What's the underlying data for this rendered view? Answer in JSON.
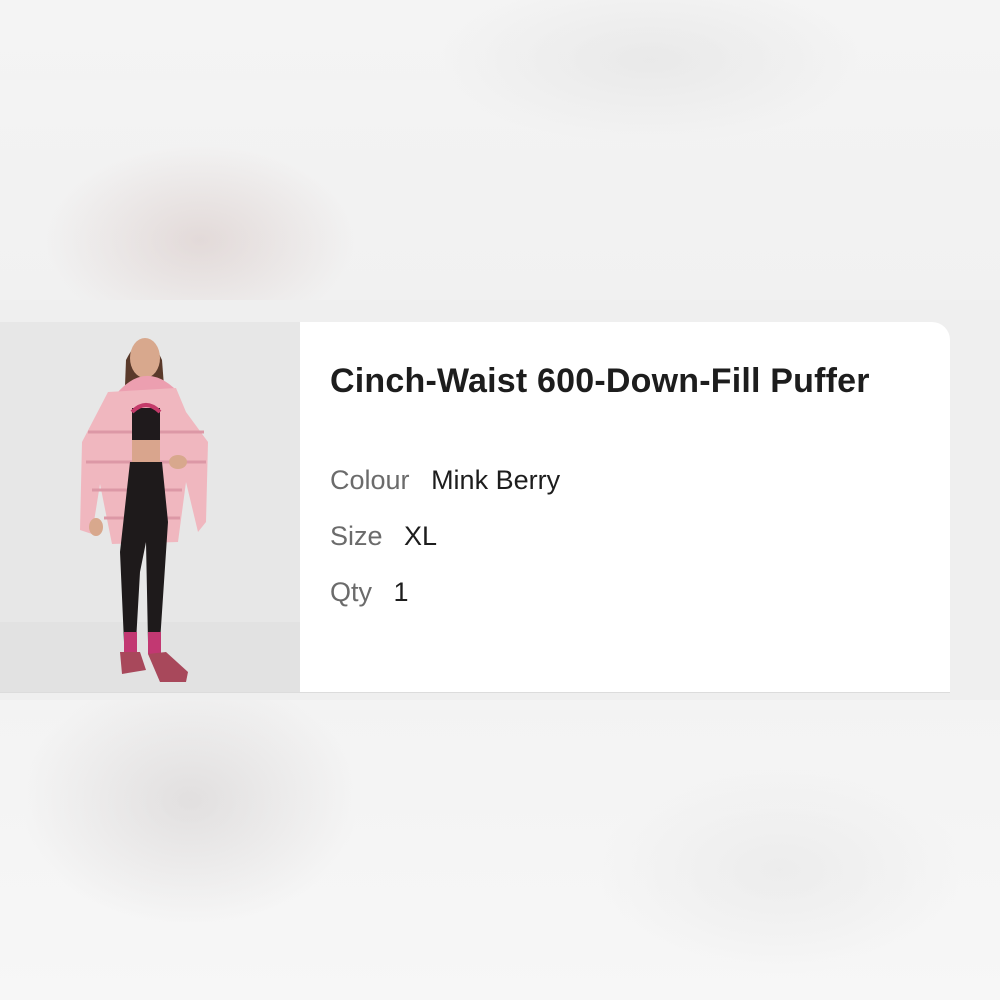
{
  "product": {
    "title": "Cinch-Waist 600-Down-Fill Puffer",
    "image_icon": "product-photo-pink-puffer-jacket"
  },
  "attributes": [
    {
      "label": "Colour",
      "value": "Mink Berry"
    },
    {
      "label": "Size",
      "value": "XL"
    },
    {
      "label": "Qty",
      "value": "1"
    }
  ],
  "colors": {
    "jacket": "#f0b7bf",
    "leggings": "#1e1a1b",
    "shoes": "#a8485b"
  }
}
